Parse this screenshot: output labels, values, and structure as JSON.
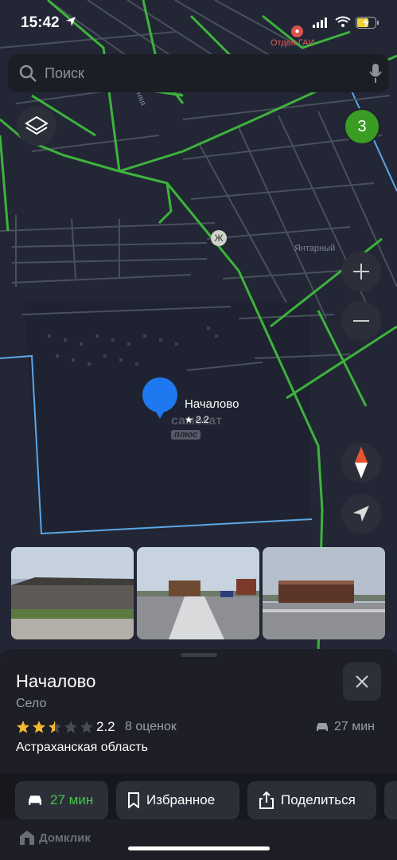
{
  "status_bar": {
    "time": "15:42"
  },
  "map": {
    "poi_gai": {
      "label": "Отдел ГАИ"
    },
    "zh_poi": "Ж",
    "district_label": "Янтарный",
    "street_label": "няя",
    "place_name": "Началово",
    "place_rating": "★ 2.2",
    "watermark": "самокат",
    "watermark_plus": "плюс",
    "traffic_level": "3"
  },
  "search": {
    "placeholder": "Поиск"
  },
  "place": {
    "title": "Началово",
    "type": "Село",
    "rating": "2.2",
    "rating_stars": 2.5,
    "rating_count": "8 оценок",
    "eta": "27 мин",
    "region": "Астраханская область"
  },
  "actions": {
    "route": "27 мин",
    "favorite": "Избранное",
    "share": "Поделиться"
  },
  "footer": {
    "brand": "Домклик"
  },
  "colors": {
    "road_green": "#3db33c",
    "accent_blue": "#1e78f0",
    "route_green": "#46c54b"
  }
}
